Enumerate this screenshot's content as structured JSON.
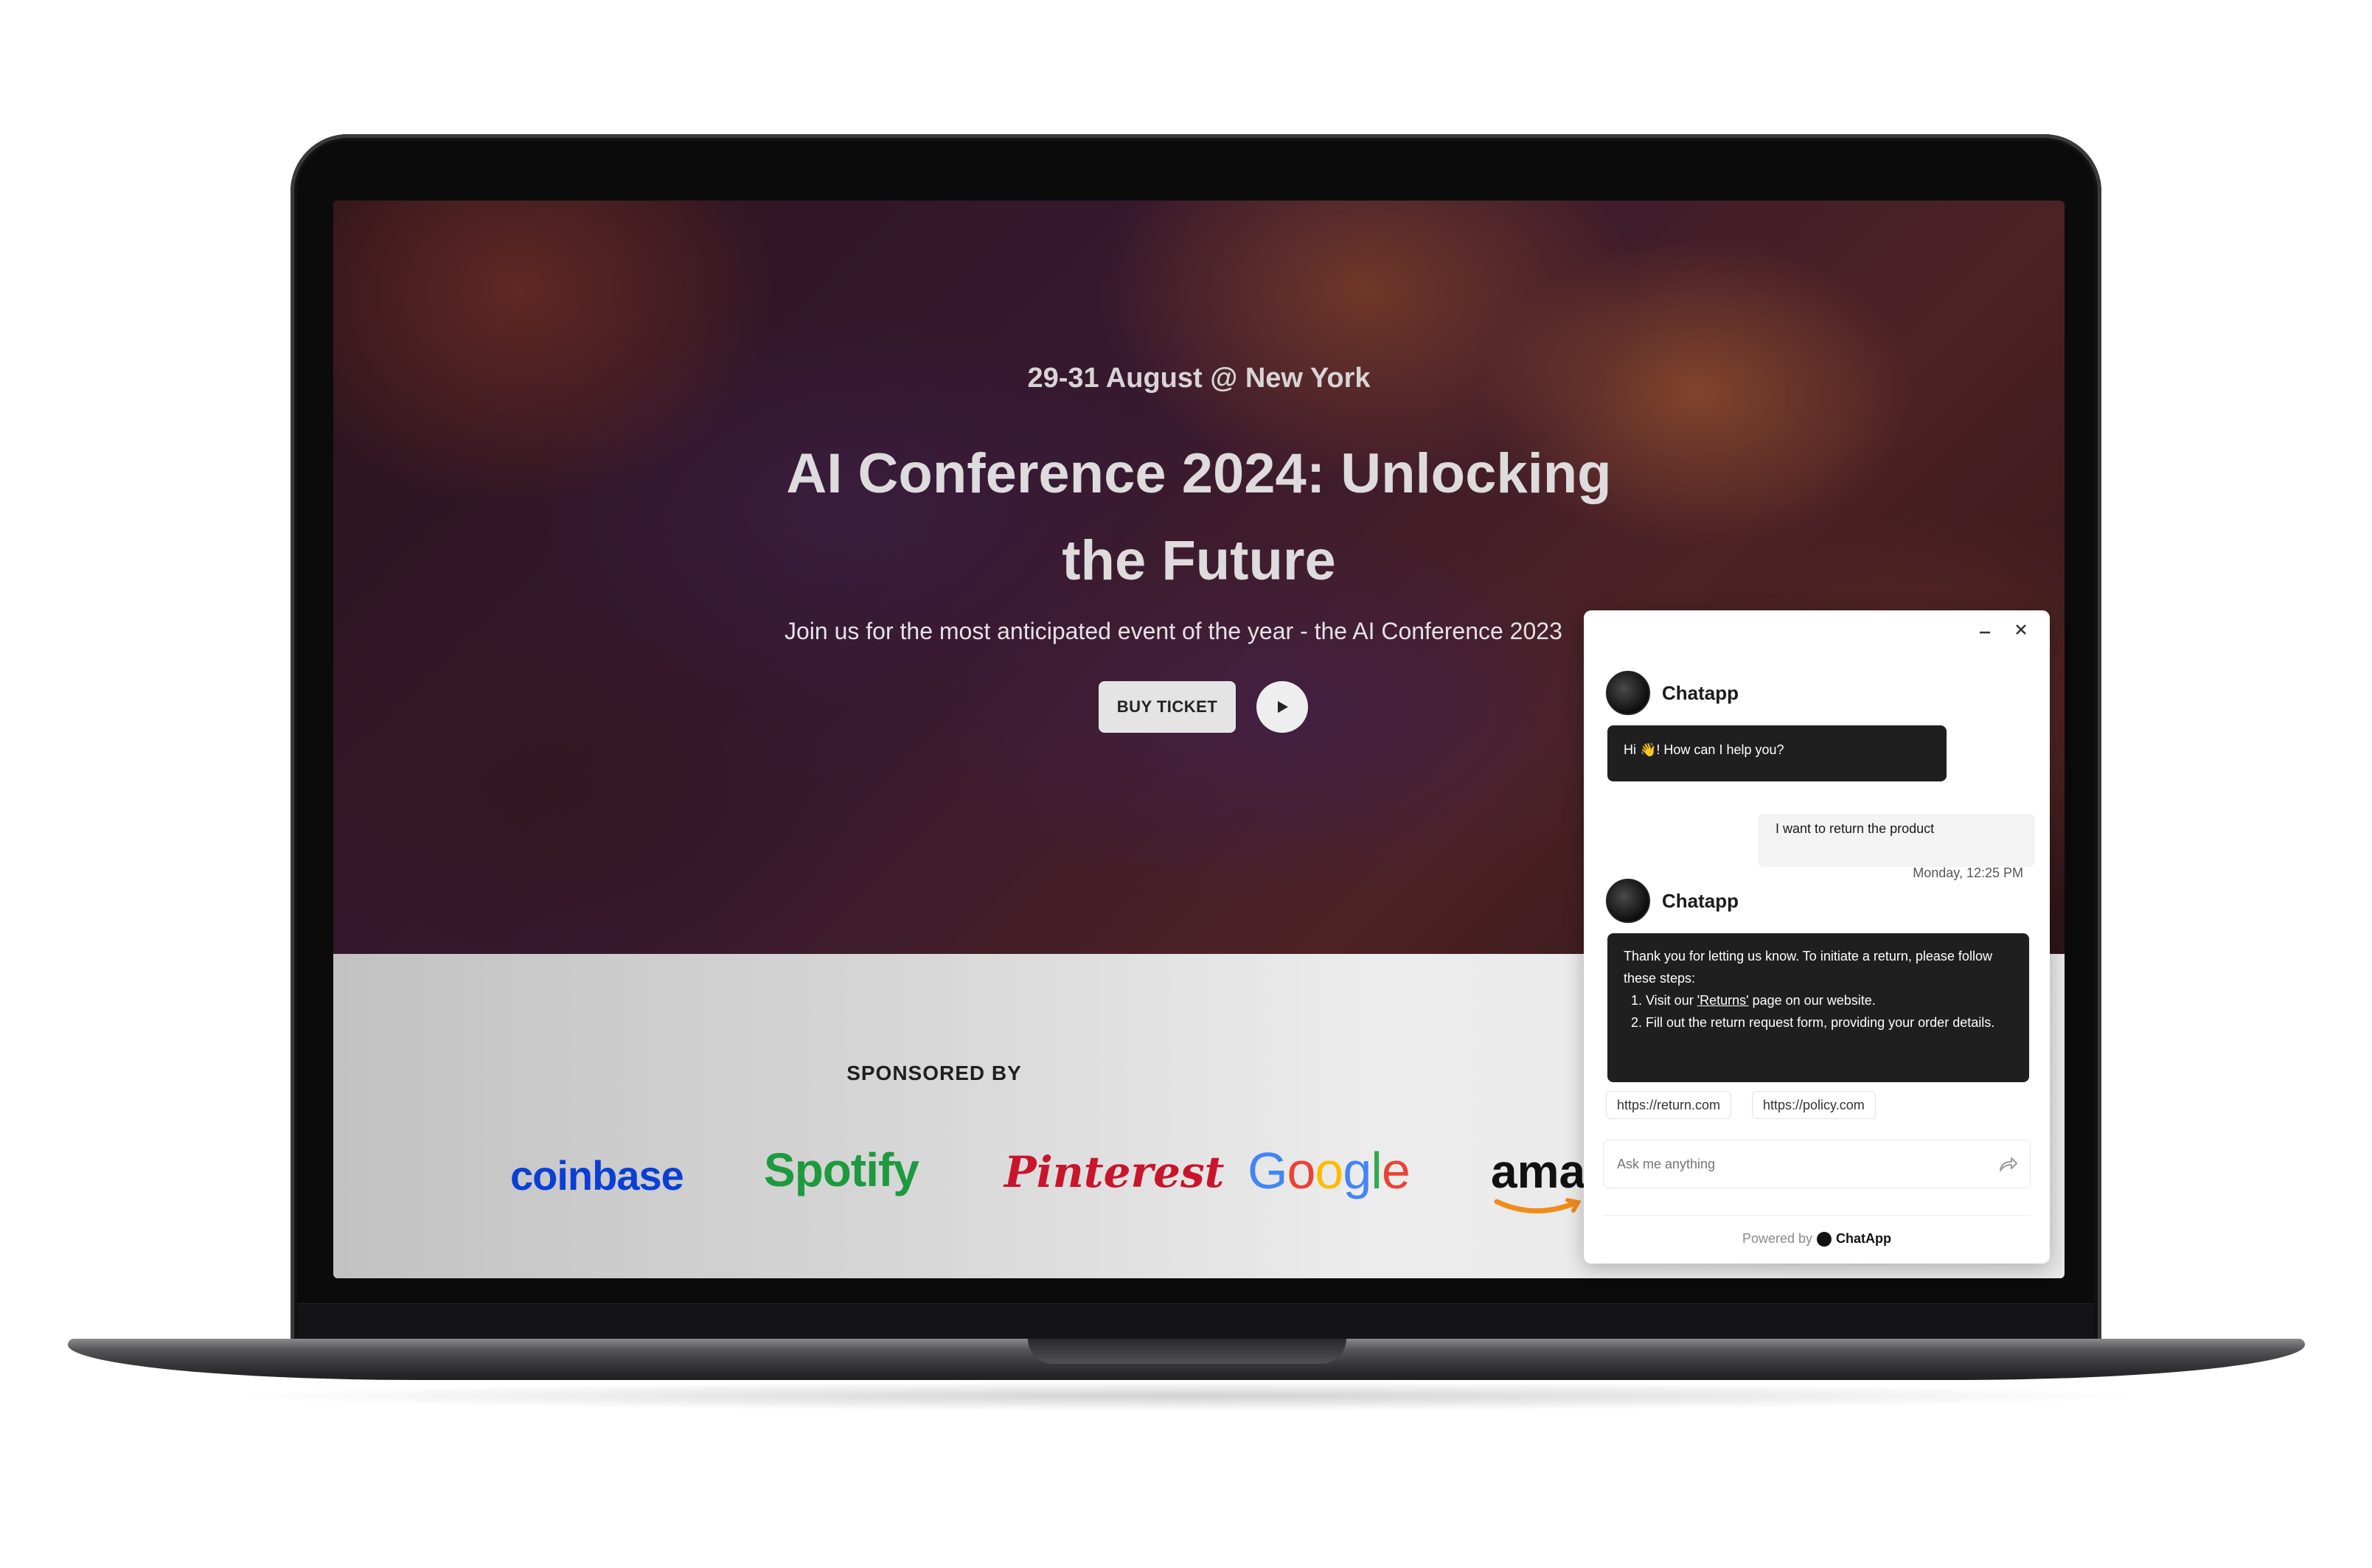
{
  "hero": {
    "date_location": "29-31 August @ New York",
    "title": "AI Conference 2024: Unlocking the Future",
    "subtitle": "Join us for the most anticipated event of the year - the AI Conference 2023",
    "buy_ticket": "BUY TICKET",
    "play_icon": "play-icon"
  },
  "sponsors": {
    "heading": "SPONSORED BY",
    "logos": [
      "coinbase",
      "Spotify",
      "Pinterest",
      "Google",
      "amaz"
    ]
  },
  "chat": {
    "bot_name": "Chatapp",
    "greeting": "Hi 👋! How can I help you?",
    "user_message": "I want to return the product",
    "timestamp": "Monday, 12:25 PM",
    "reply_intro": "Thank you for letting us know. To initiate a return, please follow these steps:",
    "steps": [
      {
        "before": "Visit our ",
        "link": "'Returns'",
        "after": " page on our website."
      },
      {
        "text": "Fill out the return request form, providing your order details."
      }
    ],
    "links": [
      "https://return.com",
      "https://policy.com"
    ],
    "input_placeholder": "Ask me anything",
    "powered_by": "Powered by",
    "powered_brand": "ChatApp",
    "minimize_icon": "minimize-icon",
    "close_icon": "close-icon",
    "send_icon": "send-icon"
  },
  "colors": {
    "chat_bubble": "#1f1f1f",
    "coinbase": "#0a3fd6",
    "spotify": "#1e9a3e",
    "pinterest": "#c8152b"
  }
}
